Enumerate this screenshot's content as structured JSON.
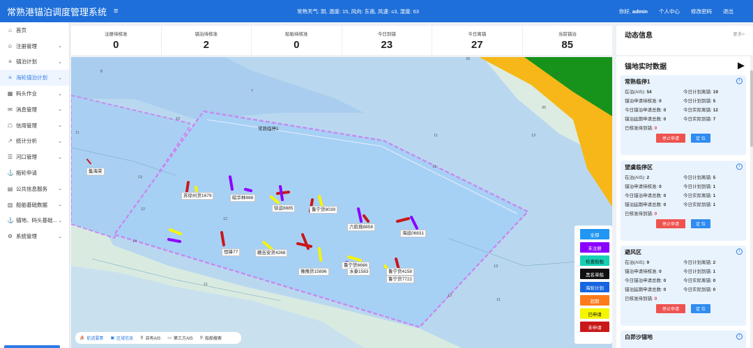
{
  "header": {
    "title": "常熟港锚泊调度管理系统",
    "menu_icon": "hamburger-icon",
    "weather": "常熟天气: 阴,  温度: 15,  风向: 东南,  风速: ≤3,  湿度: 63",
    "greeting": "你好,",
    "username": "admin",
    "profile": "个人中心",
    "change_password": "修改密码",
    "logout": "退出"
  },
  "sidebar": {
    "items": [
      {
        "label": "首页",
        "icon": "home-icon",
        "chevron": false,
        "active": false
      },
      {
        "label": "注册管理",
        "icon": "user-icon",
        "chevron": true,
        "active": false
      },
      {
        "label": "锚泊计划",
        "icon": "list-icon",
        "chevron": true,
        "active": false
      },
      {
        "label": "海轮锚泊计划",
        "icon": "list-icon",
        "chevron": true,
        "active": true
      },
      {
        "label": "码头作业",
        "icon": "grid-icon",
        "chevron": true,
        "active": false
      },
      {
        "label": "消息管理",
        "icon": "message-icon",
        "chevron": true,
        "active": false
      },
      {
        "label": "信用管理",
        "icon": "bank-icon",
        "chevron": true,
        "active": false
      },
      {
        "label": "统计分析",
        "icon": "chart-icon",
        "chevron": true,
        "active": false
      },
      {
        "label": "河口管理",
        "icon": "doc-icon",
        "chevron": true,
        "active": false
      },
      {
        "label": "拖轮申请",
        "icon": "tug-icon",
        "chevron": false,
        "active": false
      },
      {
        "label": "公共信息服务",
        "icon": "layers-icon",
        "chevron": true,
        "active": false
      },
      {
        "label": "船舶基础数据",
        "icon": "database-icon",
        "chevron": true,
        "active": false
      },
      {
        "label": "锚地、码头基础...",
        "icon": "anchor-icon",
        "chevron": true,
        "active": false
      },
      {
        "label": "系统管理",
        "icon": "gear-icon",
        "chevron": true,
        "active": false
      }
    ]
  },
  "stats": [
    {
      "label": "注册待核准",
      "value": "0"
    },
    {
      "label": "锚泊待核准",
      "value": "2"
    },
    {
      "label": "船舶待核准",
      "value": "0"
    },
    {
      "label": "今日到锚",
      "value": "23"
    },
    {
      "label": "今日离锚",
      "value": "27"
    },
    {
      "label": "当前锚泊",
      "value": "85"
    }
  ],
  "map": {
    "anchorage_label": "常熟临停1",
    "ship_labels": [
      {
        "text": "集海荣"
      },
      {
        "text": "苏徐州货1679"
      },
      {
        "text": "皖华林888"
      },
      {
        "text": "徐运8885"
      },
      {
        "text": "鲁宁货8039"
      },
      {
        "text": "六航拖8858"
      },
      {
        "text": "海巡06831"
      },
      {
        "text": "恒锋77"
      },
      {
        "text": "赣吉安货4268"
      },
      {
        "text": "豫豫货15896"
      },
      {
        "text": "鲁宁货6666"
      },
      {
        "text": "水泰1583"
      },
      {
        "text": "鲁宁货4158"
      },
      {
        "text": "鲁宁货7722"
      }
    ],
    "legend": [
      {
        "label": "全部",
        "color": "#2196f3"
      },
      {
        "label": "未注册",
        "color": "#8b00ff"
      },
      {
        "label": "检查船舶",
        "color": "#17d1b4"
      },
      {
        "label": "黑名单船",
        "color": "#111111"
      },
      {
        "label": "海轮计划",
        "color": "#1565e0"
      },
      {
        "label": "超期",
        "color": "#ff7a1a"
      },
      {
        "label": "已申请",
        "color": "#f5f500"
      },
      {
        "label": "未申请",
        "color": "#c91818"
      }
    ],
    "tools": [
      {
        "label": "航道要素",
        "icon": "ship-icon",
        "active": true
      },
      {
        "label": "区域信息",
        "icon": "area-icon",
        "active": true
      },
      {
        "label": "自有AIS",
        "icon": "search-icon",
        "active": false
      },
      {
        "label": "第三方AIS",
        "icon": "monitor-icon",
        "active": false
      },
      {
        "label": "船舶搜索",
        "icon": "search-icon",
        "active": false
      }
    ]
  },
  "dynamic": {
    "title": "动态信息",
    "more": "更多>"
  },
  "realtime": {
    "title": "锚地实时数据",
    "stop_label": "停止申请",
    "locate_label": "定 位",
    "cards": [
      {
        "name": "常熟临停1",
        "in_anchor": "54",
        "plan_depart": "19",
        "pending": "0",
        "plan_arrive": "5",
        "apply_total": "0",
        "actual_depart": "12",
        "extend_total": "0",
        "actual_arrive": "7",
        "approved_unarrived": "0"
      },
      {
        "name": "望虞临停区",
        "in_anchor": "2",
        "plan_depart": "5",
        "pending": "0",
        "plan_arrive": "1",
        "apply_total": "0",
        "actual_depart": "1",
        "extend_total": "0",
        "actual_arrive": "1",
        "approved_unarrived": "0"
      },
      {
        "name": "避风区",
        "in_anchor": "9",
        "plan_depart": "2",
        "pending": "0",
        "plan_arrive": "1",
        "apply_total": "0",
        "actual_depart": "0",
        "extend_total": "0",
        "actual_arrive": "0",
        "approved_unarrived": "0"
      },
      {
        "name": "白茆沙锚地"
      }
    ],
    "labels": {
      "in_anchor": "在泊(AIS):",
      "plan_depart": "今日计划离锚:",
      "pending": "锚泊申请待核准:",
      "plan_arrive": "今日计划到锚:",
      "apply_total": "今日锚泊申请总数:",
      "actual_depart": "今日实际离锚:",
      "extend_total": "锚泊延期申请总数:",
      "actual_arrive": "今日实际到锚:",
      "approved_unarrived": "已核准待到锚:"
    }
  }
}
